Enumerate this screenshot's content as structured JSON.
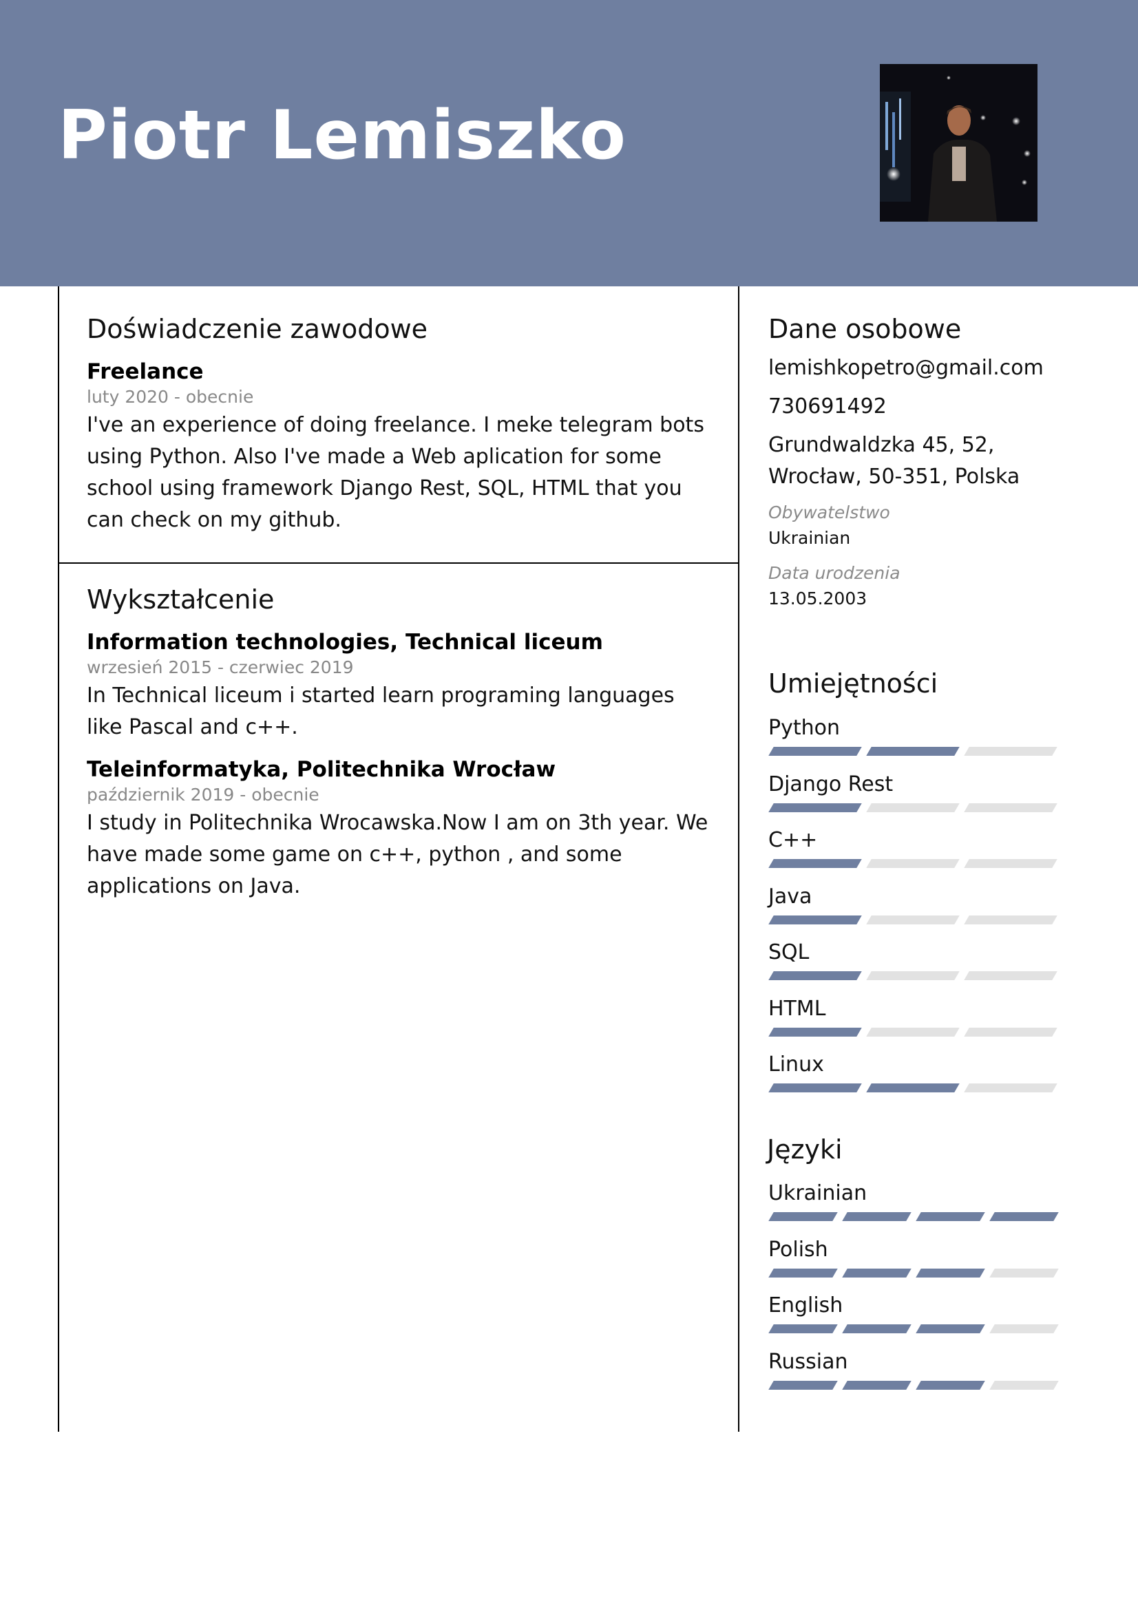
{
  "header": {
    "name": "Piotr Lemiszko",
    "accent_color": "#6f7fa0",
    "photo_alt": "profile-photo"
  },
  "experience": {
    "title": "Doświadczenie zawodowe",
    "items": [
      {
        "title": "Freelance",
        "date": "luty 2020 - obecnie",
        "description": "I've an experience of doing freelance. I meke  telegram bots using Python. Also I've made a Web aplication for some  school using framework Django Rest, SQL, HTML that you can check on my github."
      }
    ]
  },
  "education": {
    "title": "Wykształcenie",
    "items": [
      {
        "title": "Information technologies, Technical liceum",
        "date": "wrzesień 2015 - czerwiec 2019",
        "description": "In Technical liceum i started learn programing languages like Pascal and c++."
      },
      {
        "title": "Teleinformatyka, Politechnika Wrocław",
        "date": "październik 2019 - obecnie",
        "description": "I study in Politechnika Wrocawska.Now I am on 3th year. We have made some game on c++, python , and some applications on Java."
      }
    ]
  },
  "personal": {
    "title": "Dane osobowe",
    "email": "lemishkopetro@gmail.com",
    "phone": "730691492",
    "address_line1": "Grundwaldzka 45, 52,",
    "address_line2": "Wrocław, 50-351, Polska",
    "citizenship_label": "Obywatelstwo",
    "citizenship_value": "Ukrainian",
    "birthdate_label": "Data urodzenia",
    "birthdate_value": "13.05.2003"
  },
  "skills": {
    "title": "Umiejętności",
    "max_level": 3,
    "items": [
      {
        "name": "Python",
        "level": 2
      },
      {
        "name": "Django Rest",
        "level": 1
      },
      {
        "name": "C++",
        "level": 1
      },
      {
        "name": "Java",
        "level": 1
      },
      {
        "name": "SQL",
        "level": 1
      },
      {
        "name": "HTML",
        "level": 1
      },
      {
        "name": "Linux",
        "level": 2
      }
    ]
  },
  "languages": {
    "title": "Języki",
    "max_level": 4,
    "items": [
      {
        "name": "Ukrainian",
        "level": 4
      },
      {
        "name": "Polish",
        "level": 3
      },
      {
        "name": "English",
        "level": 3
      },
      {
        "name": "Russian",
        "level": 3
      }
    ]
  }
}
